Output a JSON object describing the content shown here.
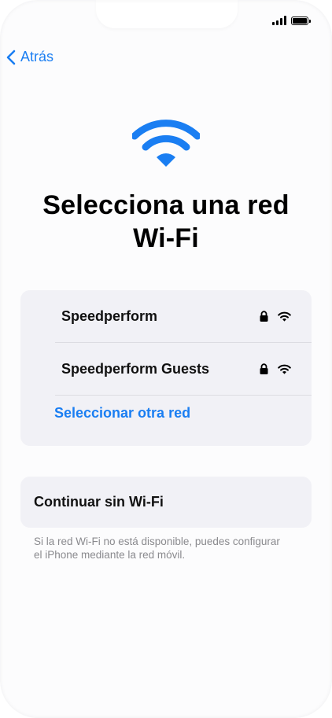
{
  "status_bar": {
    "signal_icon": "cellular-signal-icon",
    "battery_icon": "battery-icon"
  },
  "nav": {
    "back_label": "Atrás",
    "back_icon": "chevron-left-icon"
  },
  "header": {
    "hero_icon": "wifi-icon",
    "title_line1": "Selecciona una red",
    "title_line2": "Wi-Fi"
  },
  "networks": [
    {
      "name": "Speedperform",
      "secure_icon": "lock-icon",
      "signal_icon": "wifi-signal-icon"
    },
    {
      "name": "Speedperform Guests",
      "secure_icon": "lock-icon",
      "signal_icon": "wifi-signal-icon"
    }
  ],
  "other_network_label": "Seleccionar otra red",
  "continue_label": "Continuar sin Wi-Fi",
  "footer_note": "Si la red Wi-Fi no está disponible, puedes configurar el iPhone mediante la red móvil.",
  "colors": {
    "accent": "#1a7ef2",
    "card_bg": "#f1f1f6",
    "note_text": "#8a8a8e"
  }
}
